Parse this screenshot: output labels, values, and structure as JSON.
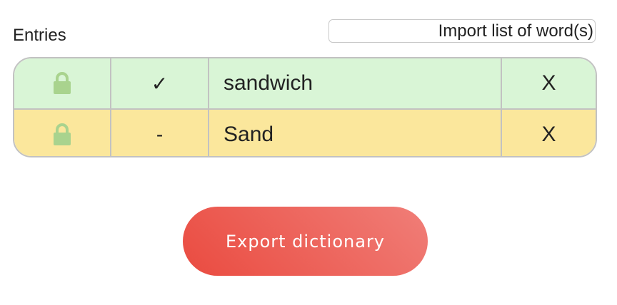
{
  "header": {
    "entries_label": "Entries",
    "import_button": "Import list of word(s)"
  },
  "entries": [
    {
      "lock_icon": "lock-icon",
      "status": "✓",
      "word": "sandwich",
      "delete_label": "X",
      "state": "accepted",
      "row_color": "#d9f5d6"
    },
    {
      "lock_icon": "lock-icon",
      "status": "-",
      "word": "Sand",
      "delete_label": "X",
      "state": "pending",
      "row_color": "#fbe79c"
    }
  ],
  "footer": {
    "export_button": "Export dictionary",
    "export_color": "#ea4b40"
  },
  "colors": {
    "lock_icon": "#a9d38e",
    "border": "#c2c2c2"
  }
}
